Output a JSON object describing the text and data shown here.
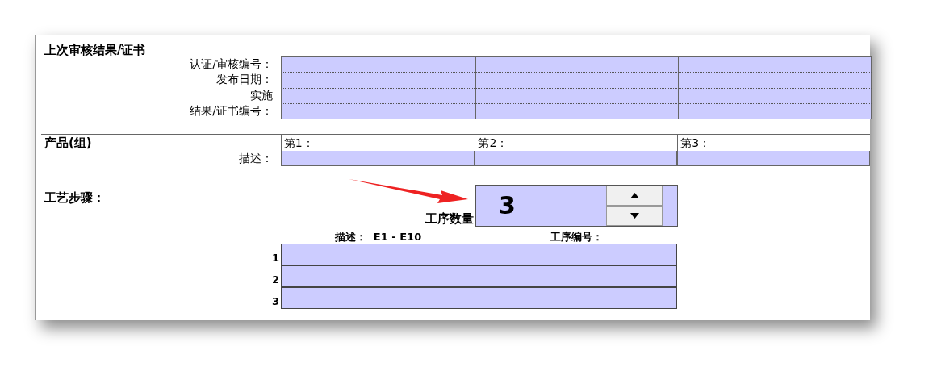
{
  "audit": {
    "title": "上次审核结果/证书",
    "fields": [
      {
        "label": "认证/审核编号："
      },
      {
        "label": "发布日期："
      },
      {
        "label": "实施"
      },
      {
        "label": "结果/证书编号："
      }
    ]
  },
  "product": {
    "title": "产品(组)",
    "columns": [
      "第1：",
      "第2：",
      "第3："
    ],
    "description_label": "描述："
  },
  "process": {
    "title": "工艺步骤：",
    "count_label": "工序数量",
    "count": "3",
    "columns": [
      "描述：  E1 - E10",
      "工序编号："
    ],
    "rows": [
      {
        "number": "1"
      },
      {
        "number": "2"
      },
      {
        "number": "3"
      }
    ]
  }
}
